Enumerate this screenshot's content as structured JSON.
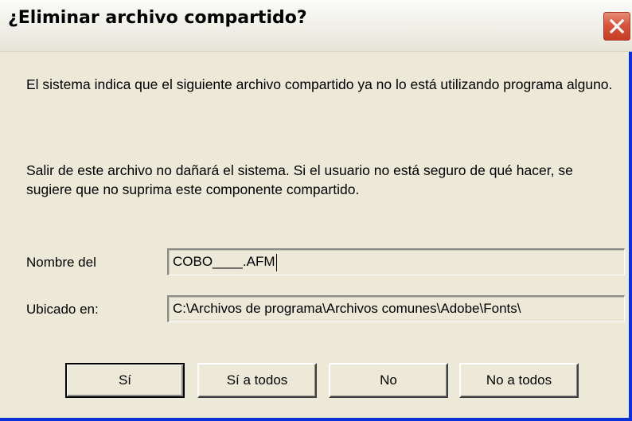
{
  "window": {
    "title": "¿Eliminar archivo compartido?"
  },
  "message": {
    "paragraph1": "El sistema indica que el siguiente archivo compartido ya no lo está utilizando programa alguno.",
    "paragraph2": "Salir de este archivo no dañará el sistema. Si el usuario no está seguro de qué hacer, se sugiere que no suprima este componente compartido."
  },
  "fields": {
    "name_label": "Nombre del",
    "name_value": "COBO____.AFM",
    "location_label": "Ubicado en:",
    "location_value": "C:\\Archivos de programa\\Archivos comunes\\Adobe\\Fonts\\"
  },
  "buttons": {
    "yes": "Sí",
    "yes_all": "Sí a todos",
    "no": "No",
    "no_all": "No a todos"
  },
  "icons": {
    "close": "close-icon"
  },
  "colors": {
    "window_bg": "#ece9d8",
    "close_button": "#d8563d",
    "frame_border": "#0831d9"
  }
}
